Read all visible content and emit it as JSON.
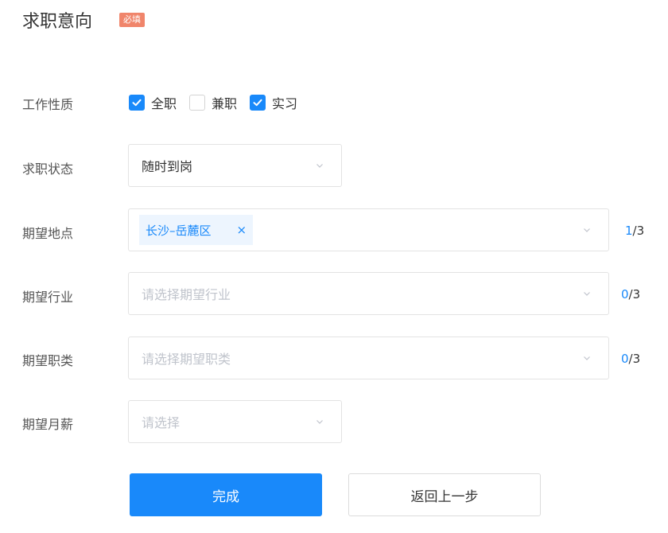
{
  "header": {
    "title": "求职意向",
    "required_badge": "必填"
  },
  "work_nature": {
    "label": "工作性质",
    "options": [
      {
        "label": "全职",
        "checked": true
      },
      {
        "label": "兼职",
        "checked": false
      },
      {
        "label": "实习",
        "checked": true
      }
    ]
  },
  "job_status": {
    "label": "求职状态",
    "value": "随时到岗"
  },
  "location": {
    "label": "期望地点",
    "tag": "长沙–岳麓区",
    "tag_close": "×",
    "count": "1",
    "max": "/3"
  },
  "industry": {
    "label": "期望行业",
    "placeholder": "请选择期望行业",
    "count": "0",
    "max": "/3"
  },
  "job_category": {
    "label": "期望职类",
    "placeholder": "请选择期望职类",
    "count": "0",
    "max": "/3"
  },
  "salary": {
    "label": "期望月薪",
    "placeholder": "请选择"
  },
  "buttons": {
    "finish": "完成",
    "back": "返回上一步"
  },
  "colors": {
    "accent": "#1989fa",
    "badge": "#f0856b",
    "tag_bg": "#edf5fe"
  },
  "icons": {
    "dropdown": "chevron-down-icon",
    "check": "checkmark-icon",
    "remove": "close-icon"
  }
}
